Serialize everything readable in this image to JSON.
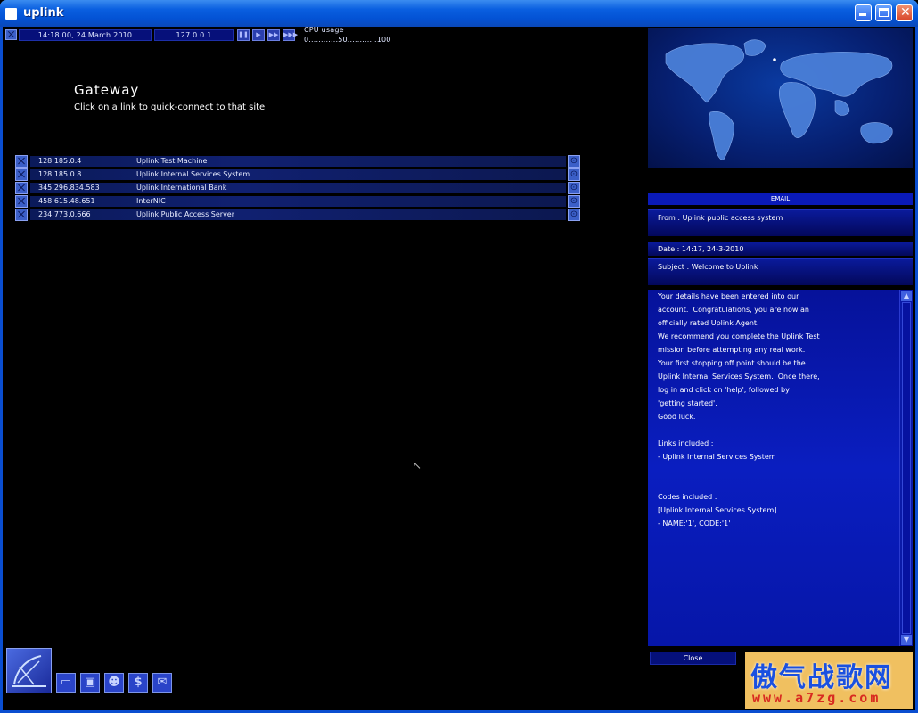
{
  "window": {
    "title": "uplink"
  },
  "hud": {
    "datetime": "14:18.00, 24 March 2010",
    "ip": "127.0.0.1",
    "cpu_label": "CPU usage",
    "cpu_scale": "0............50............100"
  },
  "gateway": {
    "title": "Gateway",
    "subtitle": "Click on a link to quick-connect to that site",
    "links": [
      {
        "ip": "128.185.0.4",
        "name": "Uplink Test Machine"
      },
      {
        "ip": "128.185.0.8",
        "name": "Uplink Internal Services System"
      },
      {
        "ip": "345.296.834.583",
        "name": "Uplink International Bank"
      },
      {
        "ip": "458.615.48.651",
        "name": "InterNIC"
      },
      {
        "ip": "234.773.0.666",
        "name": "Uplink Public Access Server"
      }
    ]
  },
  "email": {
    "header": "EMAIL",
    "from": "From : Uplink public access system",
    "date": "Date : 14:17, 24-3-2010",
    "subject": "Subject : Welcome to Uplink",
    "body": [
      "Your details have been entered into our",
      "account.  Congratulations, you are now an",
      "officially rated Uplink Agent.",
      "We recommend you complete the Uplink Test",
      "mission before attempting any real work.",
      "Your first stopping off point should be the",
      "Uplink Internal Services System.  Once there,",
      "log in and click on 'help', followed by",
      "'getting started'.",
      "Good luck.",
      "",
      "Links included :",
      "- Uplink Internal Services System",
      "",
      "",
      "Codes included :",
      "[Uplink Internal Services System]",
      "- NAME:'1', CODE:'1'"
    ],
    "close_label": "Close"
  },
  "watermark": {
    "line1": "傲气战歌网",
    "line2": "www.a7zg.com"
  },
  "colors": {
    "accent": "#0a1ab8",
    "titlebar": "#0352d4",
    "background": "#000000"
  },
  "icons": {
    "main": "uplink-logo-icon",
    "toolbar": [
      "computer-icon",
      "floppy-disk-icon",
      "person-icon",
      "dollar-icon",
      "envelope-icon"
    ]
  }
}
